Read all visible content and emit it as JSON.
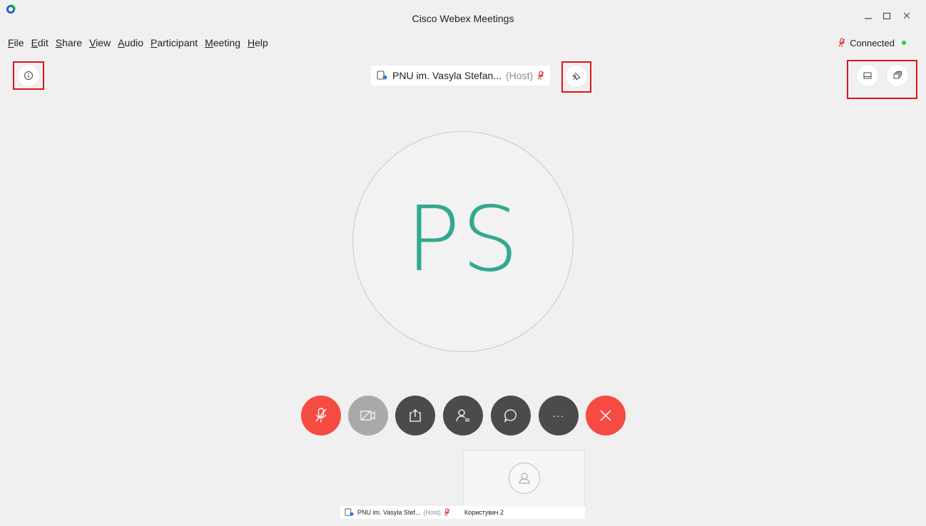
{
  "window": {
    "title": "Cisco Webex Meetings",
    "controls": [
      "minimize",
      "maximize",
      "close"
    ]
  },
  "menu": [
    {
      "accel": "F",
      "rest": "ile"
    },
    {
      "accel": "E",
      "rest": "dit"
    },
    {
      "accel": "S",
      "rest": "hare"
    },
    {
      "accel": "V",
      "rest": "iew"
    },
    {
      "accel": "A",
      "rest": "udio"
    },
    {
      "accel": "P",
      "rest": "articipant"
    },
    {
      "accel": "M",
      "rest": "eeting"
    },
    {
      "accel": "H",
      "rest": "elp"
    }
  ],
  "status": {
    "text": "Connected",
    "color": "#2ecc40"
  },
  "active_speaker": {
    "name": "PNU im. Vasyla Stefan...",
    "role": "(Host)",
    "initials": "PS",
    "initials_color": "#33a88f"
  },
  "controls": {
    "mute": {
      "color": "#f54b42"
    },
    "video": {
      "color": "#a9a9a9"
    },
    "share": {
      "color": "#4b4b4b"
    },
    "participants": {
      "color": "#4b4b4b"
    },
    "chat": {
      "color": "#4b4b4b"
    },
    "more": {
      "color": "#4b4b4b",
      "label": "···"
    },
    "leave": {
      "color": "#f54b42"
    }
  },
  "thumbnails": {
    "host_name": "PNU im. Vasyla Stef...",
    "host_role": "(Host)",
    "self_name": "Користувач 2"
  },
  "colors": {
    "mute_red": "#e02020",
    "highlight": "#d81818"
  }
}
